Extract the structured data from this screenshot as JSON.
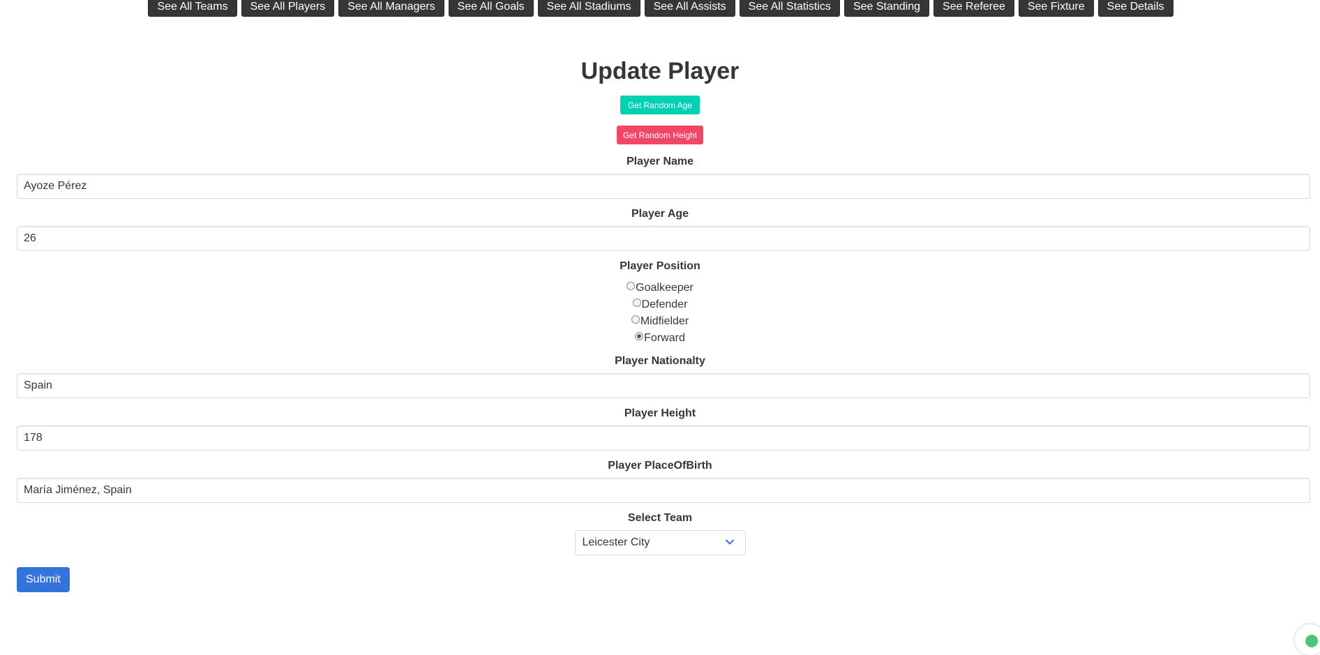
{
  "nav": {
    "items": [
      {
        "label": "See All Teams"
      },
      {
        "label": "See All Players"
      },
      {
        "label": "See All Managers"
      },
      {
        "label": "See All Goals"
      },
      {
        "label": "See All Stadiums"
      },
      {
        "label": "See All Assists"
      },
      {
        "label": "See All Statistics"
      },
      {
        "label": "See Standing"
      },
      {
        "label": "See Referee"
      },
      {
        "label": "See Fixture"
      },
      {
        "label": "See Details"
      }
    ]
  },
  "page": {
    "title": "Update Player"
  },
  "actions": {
    "random_age_label": "Get Random Age",
    "random_height_label": "Get Random Height"
  },
  "form": {
    "name_label": "Player Name",
    "name_value": "Ayoze Pérez",
    "age_label": "Player Age",
    "age_value": "26",
    "position_label": "Player Position",
    "positions": [
      {
        "label": "Goalkeeper",
        "checked": false
      },
      {
        "label": "Defender",
        "checked": false
      },
      {
        "label": "Midfielder",
        "checked": false
      },
      {
        "label": "Forward",
        "checked": true
      }
    ],
    "nationality_label": "Player Nationalty",
    "nationality_value": "Spain",
    "height_label": "Player Height",
    "height_value": "178",
    "birthplace_label": "Player PlaceOfBirth",
    "birthplace_value": "María Jiménez, Spain",
    "team_label": "Select Team",
    "team_value": "Leicester City",
    "submit_label": "Submit"
  },
  "colors": {
    "nav_bg": "#363636",
    "age_button": "#00d1b2",
    "height_button": "#f14668",
    "submit_button": "#3273dc",
    "select_chevron": "#3273dc"
  },
  "icons": {
    "select_arrow": "chevron-down-icon",
    "corner_badge": "shield-check-icon"
  }
}
